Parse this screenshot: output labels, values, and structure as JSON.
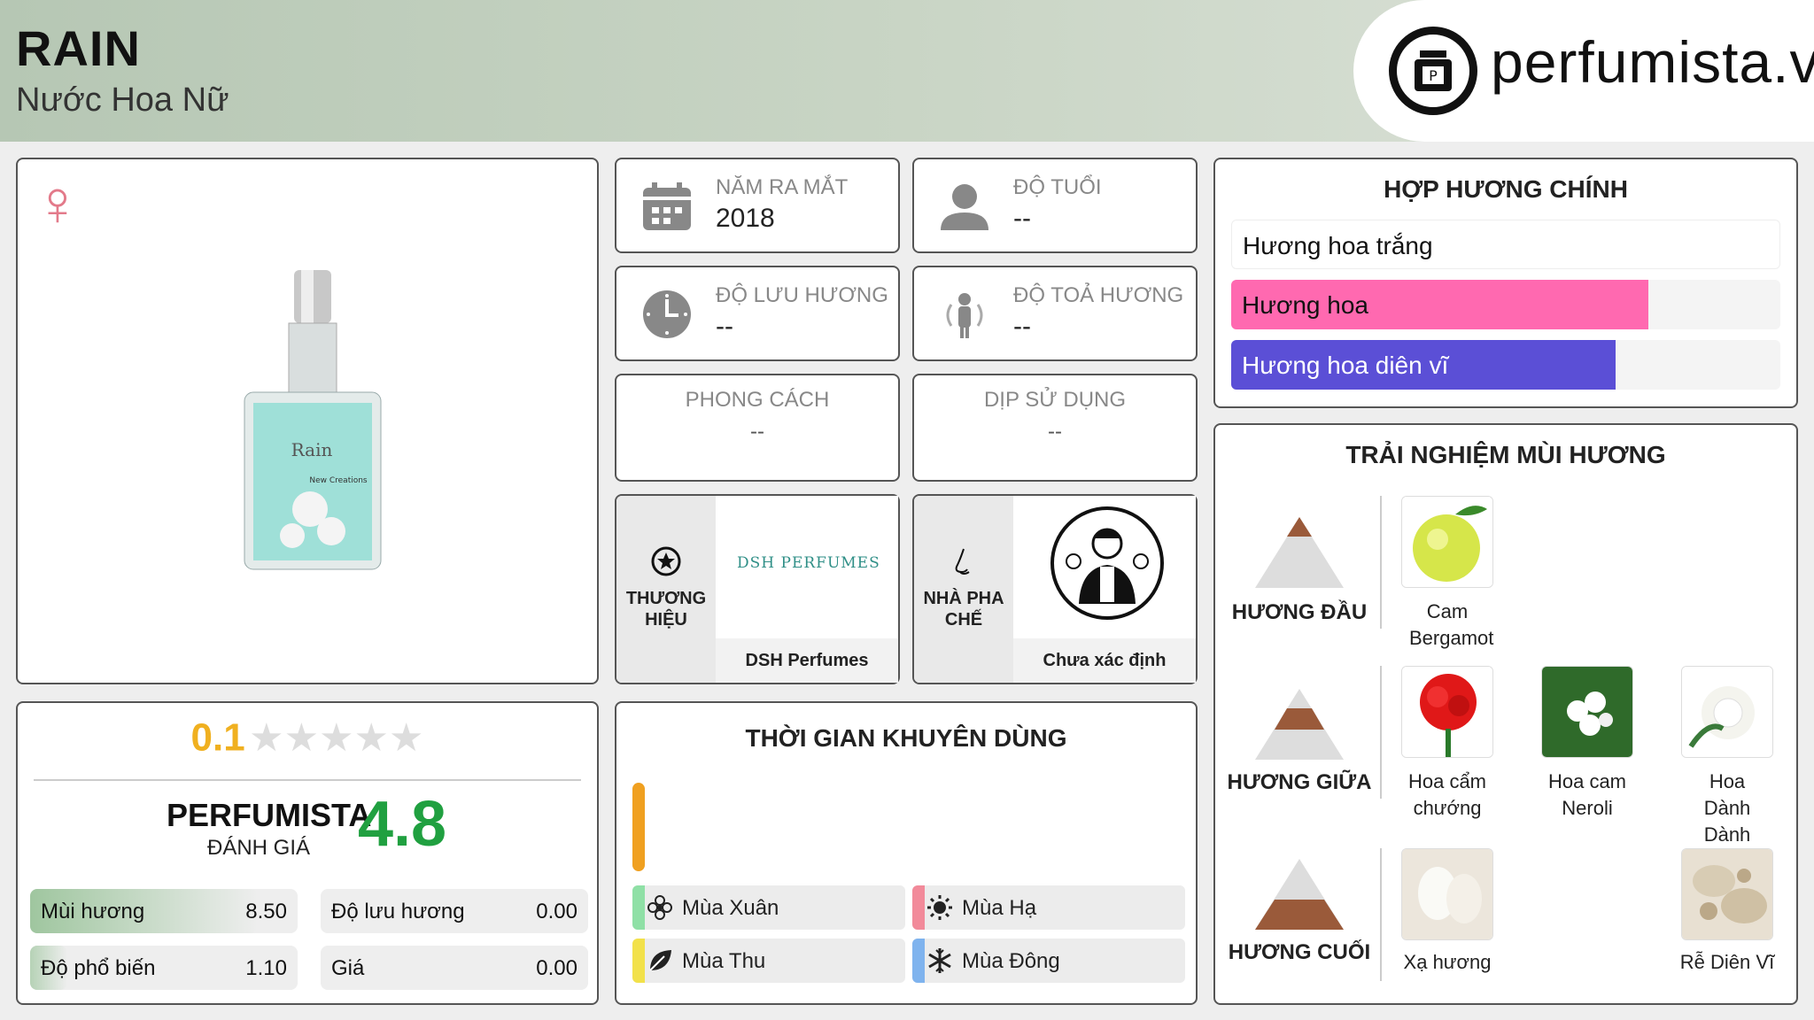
{
  "header": {
    "title": "RAIN",
    "subtitle": "Nước Hoa Nữ",
    "logo_text": "perfumista.vn"
  },
  "product": {
    "gender_icon": "venus-icon",
    "bottle_label": "Rain",
    "bottle_sub": "New Creations"
  },
  "stats": {
    "launch_year": {
      "label": "NĂM RA MẮT",
      "value": "2018"
    },
    "age": {
      "label": "ĐỘ TUỔI",
      "value": "--"
    },
    "longevity": {
      "label": "ĐỘ LƯU HƯƠNG",
      "value": "--"
    },
    "sillage": {
      "label": "ĐỘ TOẢ HƯƠNG",
      "value": "--"
    },
    "style": {
      "label": "PHONG CÁCH",
      "value": "--"
    },
    "occasion": {
      "label": "DỊP SỬ DỤNG",
      "value": "--"
    }
  },
  "brand": {
    "label": "THƯƠNG HIỆU",
    "logo_text": "DSH PERFUMES",
    "name": "DSH Perfumes"
  },
  "perfumer": {
    "label": "NHÀ PHA CHẾ",
    "name": "Chưa xác định"
  },
  "accords": {
    "title": "HỢP HƯƠNG CHÍNH",
    "items": [
      {
        "label": "Hương hoa trắng",
        "color": "#ffffff",
        "level": 0
      },
      {
        "label": "Hương hoa",
        "color": "#ff69b0",
        "level": 0.76
      },
      {
        "label": "Hương hoa diên vĩ",
        "color": "#5b4fd6",
        "level": 0.7
      }
    ]
  },
  "rating": {
    "user_score": "0.1",
    "stars": 5,
    "perfumista_label": "PERFUMISTA",
    "perfumista_sub": "ĐÁNH GIÁ",
    "perfumista_score": "4.8",
    "scores": [
      {
        "label": "Mùi hương",
        "value": "8.50",
        "fill": 0.85
      },
      {
        "label": "Độ lưu hương",
        "value": "0.00",
        "fill": 0
      },
      {
        "label": "Độ phổ biến",
        "value": "1.10",
        "fill": 0.11
      },
      {
        "label": "Giá",
        "value": "0.00",
        "fill": 0
      }
    ]
  },
  "recommend": {
    "title": "THỜI GIAN KHUYÊN DÙNG",
    "seasons": [
      {
        "label": "Mùa Xuân",
        "color": "#8fe0a6",
        "icon": "flower-icon"
      },
      {
        "label": "Mùa Hạ",
        "color": "#f28a9a",
        "icon": "sun-icon"
      },
      {
        "label": "Mùa Thu",
        "color": "#f2e14a",
        "icon": "leaf-icon"
      },
      {
        "label": "Mùa Đông",
        "color": "#7fb3ee",
        "icon": "snowflake-icon"
      }
    ]
  },
  "notes": {
    "title": "TRẢI NGHIỆM MÙI HƯƠNG",
    "top": {
      "label": "HƯƠNG ĐẦU",
      "items": [
        {
          "label": "Cam Bergamot",
          "icon": "bergamot-image"
        }
      ]
    },
    "middle": {
      "label": "HƯƠNG GIỮA",
      "items": [
        {
          "label": "Hoa cẩm chướng",
          "icon": "carnation-image"
        },
        {
          "label": "Hoa cam Neroli",
          "icon": "neroli-image"
        },
        {
          "label": "Hoa Dành Dành",
          "icon": "gardenia-image"
        }
      ]
    },
    "base": {
      "label": "HƯƠNG CUỐI",
      "items": [
        {
          "label": "Xạ hương",
          "icon": "musk-image"
        },
        {
          "label": "Rễ Diên Vĩ",
          "icon": "orris-root-image"
        }
      ]
    }
  }
}
